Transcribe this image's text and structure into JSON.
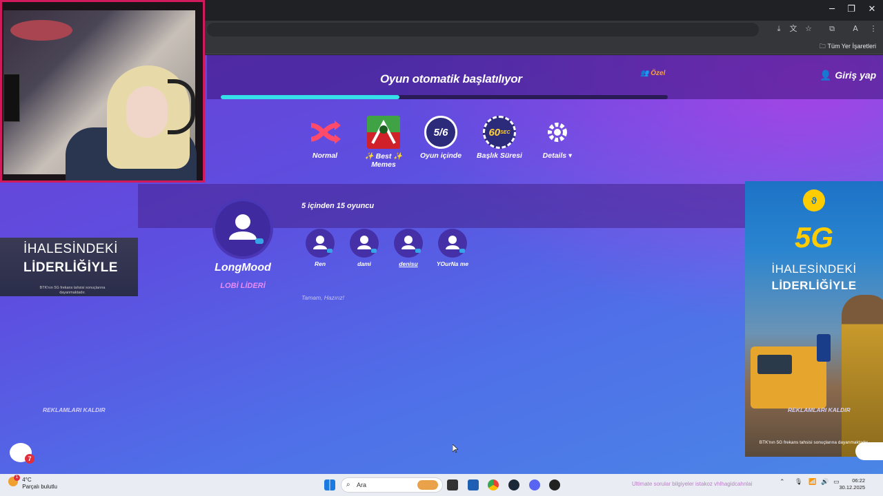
{
  "browser": {
    "window_controls": {
      "minimize": "─",
      "restore": "❐",
      "close": "✕"
    },
    "toolbar_icons": [
      "install-icon",
      "translate-icon",
      "star-icon",
      "extensions-icon",
      "profile-icon",
      "menu-icon"
    ],
    "profile_initial": "A",
    "bookmarks_label": "Tüm Yer İşaretleri"
  },
  "game": {
    "status_title": "Oyun otomatik başlatılıyor",
    "progress": 0.4,
    "private_label": "Özel",
    "login_label": "Giriş yap",
    "settings": [
      {
        "label": "Normal",
        "icon": "shuffle-icon"
      },
      {
        "label": "✨ Best ✨ Memes",
        "icon": "memes-deck-icon"
      },
      {
        "label": "Oyun içinde",
        "icon": "rounds-icon",
        "value": "5/6"
      },
      {
        "label": "Başlık Süresi",
        "icon": "timer-icon",
        "value": "60",
        "unit": "SEC"
      },
      {
        "label": "Details",
        "icon": "gear-icon"
      }
    ],
    "player_count": "5 içinden  15 oyuncu",
    "host": {
      "name": "LongMood",
      "role": "LOBİ LİDERİ"
    },
    "players": [
      "Ren",
      "dami",
      "denisu",
      "YOurNa me"
    ],
    "ready_text": "Tamam, Hazırız!",
    "remove_ads_left": "REKLAMLARI KALDIR",
    "remove_ads_right": "REKLAMLARI KALDIR",
    "chat_badge": "7"
  },
  "ads": {
    "left": {
      "line1": "İHALESİNDEKİ",
      "line2": "LİDERLİĞİYLE",
      "fine": "BTK'nın 5G frekans tahsisi sonuçlarına dayanmaktadır."
    },
    "right": {
      "headline": "5G",
      "line1": "İHALESİNDEKİ",
      "line2": "LİDERLİĞİYLE",
      "fine": "BTK'nın 5G frekans tahsisi sonuçlarına dayanmaktadır."
    }
  },
  "taskbar": {
    "weather_temp": "4°C",
    "weather_desc": "Parçalı bulutlu",
    "weather_badge": "1",
    "search_placeholder": "Ara",
    "ticker": "Ultimate sorular bilgiyeler istakoz vhlhagidcahnlai",
    "time": "06:22",
    "date": "30.12.2025"
  },
  "colors": {
    "accent": "#35e0e8",
    "private": "#f7a23b",
    "leader": "#e98cf6",
    "stream_border": "#d01a5c"
  }
}
